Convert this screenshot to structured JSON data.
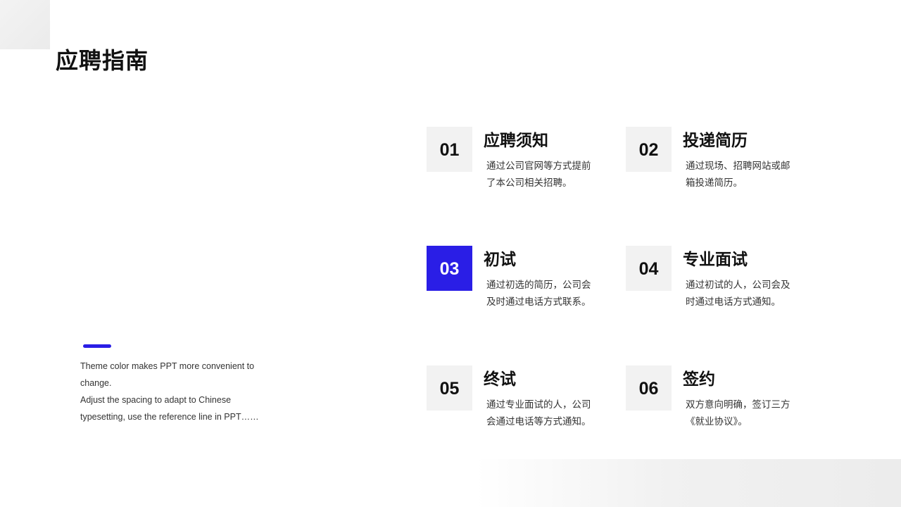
{
  "title": "应聘指南",
  "accent_color": "#2a1ee6",
  "note": {
    "line1": "Theme color makes PPT more convenient to change.",
    "line2": "Adjust the spacing to adapt to Chinese typesetting, use the reference line in PPT……"
  },
  "steps": [
    {
      "num": "01",
      "title": "应聘须知",
      "desc": "通过公司官网等方式提前了本公司相关招聘。"
    },
    {
      "num": "02",
      "title": "投递简历",
      "desc": "通过现场、招聘网站或邮箱投递简历。"
    },
    {
      "num": "03",
      "title": "初试",
      "desc": "通过初选的简历，公司会及时通过电话方式联系。"
    },
    {
      "num": "04",
      "title": "专业面试",
      "desc": "通过初试的人，公司会及时通过电话方式通知。"
    },
    {
      "num": "05",
      "title": "终试",
      "desc": "通过专业面试的人，公司会通过电话等方式通知。"
    },
    {
      "num": "06",
      "title": "签约",
      "desc": "双方意向明确，签订三方《就业协议》。"
    }
  ]
}
